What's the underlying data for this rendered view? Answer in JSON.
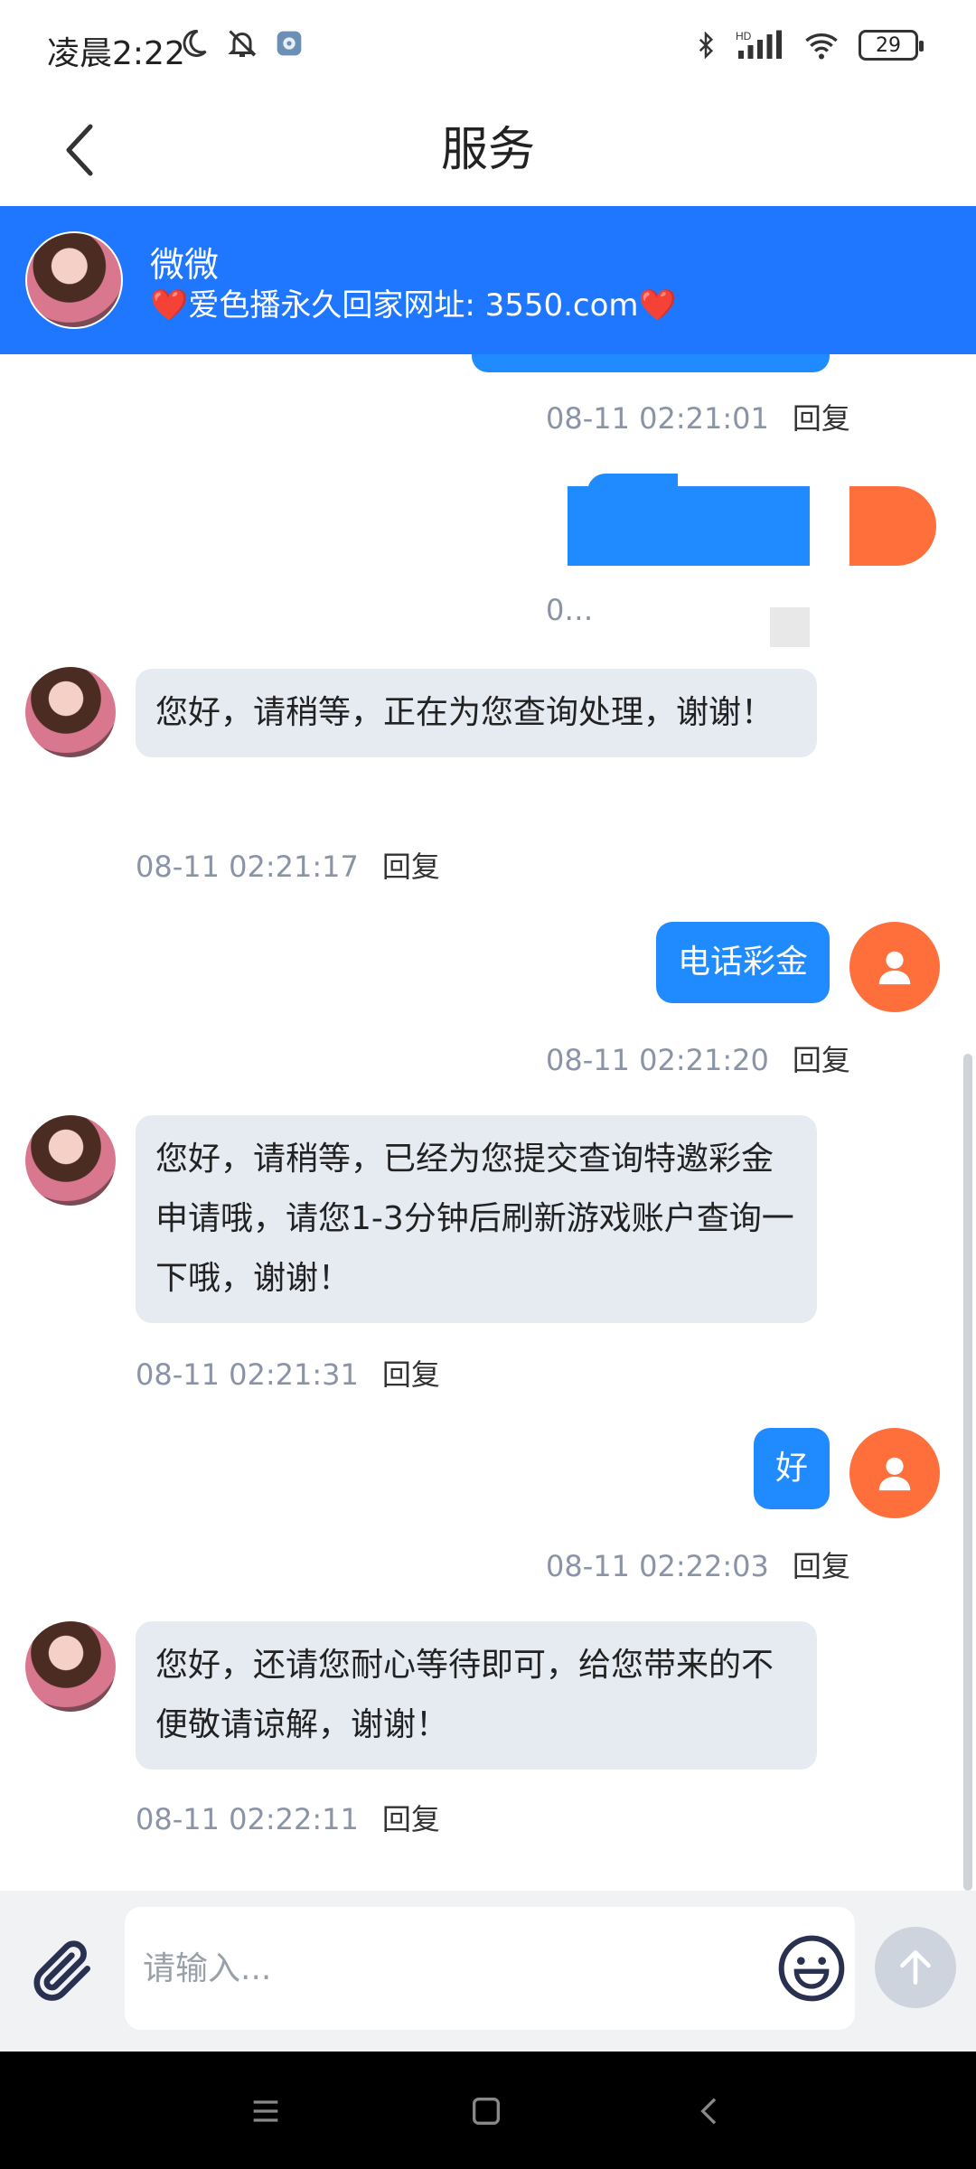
{
  "status_bar": {
    "time": "凌晨2:22",
    "battery": "29",
    "icons_left": [
      "moon-icon",
      "bell-off-icon",
      "app-icon"
    ],
    "icons_right": [
      "bluetooth-icon",
      "hd-signal-icon",
      "wifi-icon",
      "battery-icon"
    ]
  },
  "header": {
    "title": "服务"
  },
  "agent": {
    "name": "微微",
    "note": "❤️爱色播永久回家网址: 3550.com❤️"
  },
  "messages": [
    {
      "from": "user",
      "text": "",
      "time": "08-11 02:21:01",
      "reply": "回复"
    },
    {
      "from": "user",
      "text": "",
      "time": "0…",
      "reply": ""
    },
    {
      "from": "agent",
      "text": "您好，请稍等，正在为您查询处理，谢谢！",
      "time": "08-11 02:21:17",
      "reply": "回复"
    },
    {
      "from": "user",
      "text": "电话彩金",
      "time": "08-11 02:21:20",
      "reply": "回复"
    },
    {
      "from": "agent",
      "text": "您好，请稍等，已经为您提交查询特邀彩金申请哦，请您1-3分钟后刷新游戏账户查询一下哦，谢谢！",
      "time": "08-11 02:21:31",
      "reply": "回复"
    },
    {
      "from": "user",
      "text": "好",
      "time": "08-11 02:22:03",
      "reply": "回复"
    },
    {
      "from": "agent",
      "text": "您好，还请您耐心等待即可，给您带来的不便敬请谅解，谢谢！",
      "time": "08-11 02:22:11",
      "reply": "回复"
    }
  ],
  "input": {
    "placeholder": "请输入..."
  },
  "colors": {
    "accent": "#1f77ff",
    "user_bubble": "#1f8bff",
    "agent_bubble": "#e6ebf2",
    "user_avatar": "#ff6f3c"
  }
}
